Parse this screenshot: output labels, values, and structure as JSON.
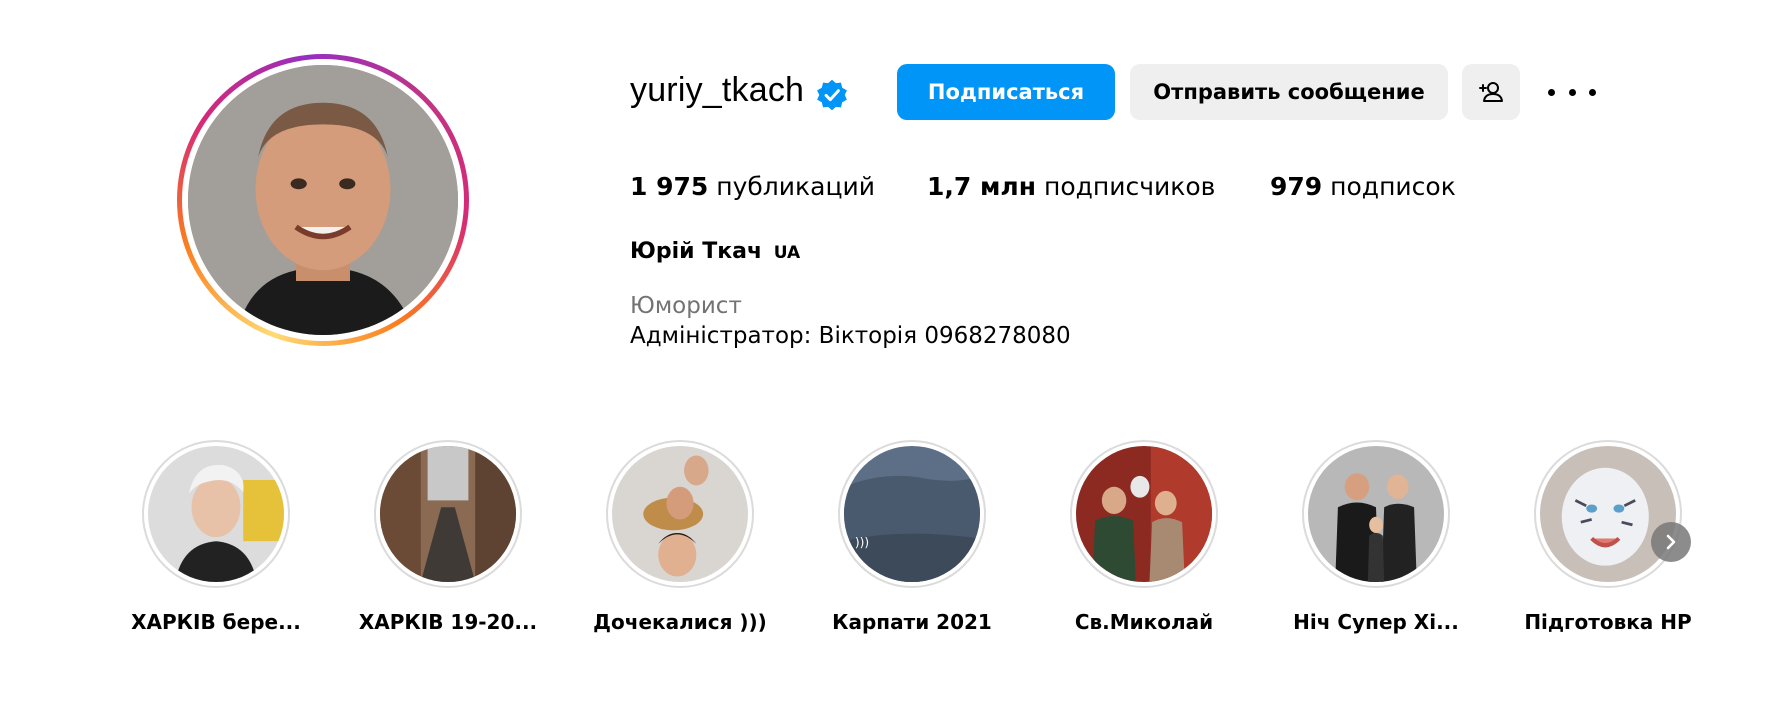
{
  "profile": {
    "username": "yuriy_tkach",
    "verified_icon": "verified-badge-icon",
    "full_name": "Юрій Ткач",
    "name_flag": "UA",
    "category": "Юморист",
    "bio": "Адміністратор: Вікторія 0968278080"
  },
  "actions": {
    "follow_label": "Подписаться",
    "message_label": "Отправить сообщение",
    "suggest_icon": "add-person-icon",
    "more_icon": "more-options-icon"
  },
  "stats": {
    "posts_count": "1 975",
    "posts_label": "публикаций",
    "followers_count": "1,7 млн",
    "followers_label": "подписчиков",
    "following_count": "979",
    "following_label": "подписок"
  },
  "highlights": [
    {
      "label": "ХАРКІВ бере..."
    },
    {
      "label": "ХАРКІВ 19-20..."
    },
    {
      "label": "Дочекалися )))"
    },
    {
      "label": "Карпати 2021"
    },
    {
      "label": "Св.Миколай"
    },
    {
      "label": "Ніч Супер Хі..."
    },
    {
      "label": "Підготовка НР"
    }
  ],
  "colors": {
    "follow_button": "#0095f6",
    "secondary_button": "#efefef",
    "verified_badge": "#0095f6",
    "category_text": "#737373"
  }
}
